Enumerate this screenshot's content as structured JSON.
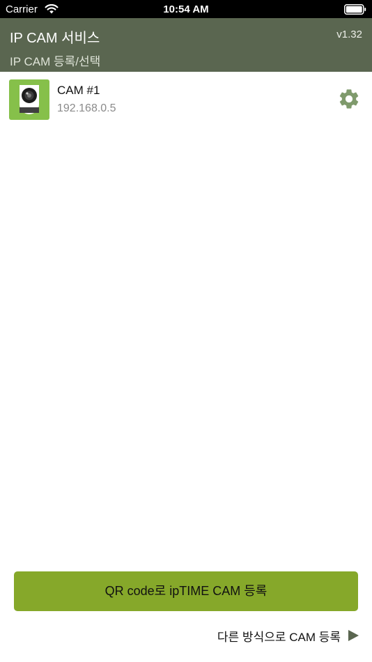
{
  "status_bar": {
    "carrier": "Carrier",
    "time": "10:54 AM",
    "icons": [
      "wifi-icon",
      "battery-icon"
    ]
  },
  "header": {
    "title": "IP CAM 서비스",
    "version": "v1.32",
    "subtitle": "IP CAM 등록/선택",
    "background_color": "#5a6650"
  },
  "cameras": [
    {
      "name": "CAM #1",
      "ip": "192.168.0.5",
      "icon": "camera-icon",
      "settings_icon": "gear-icon"
    }
  ],
  "actions": {
    "qr_register_label": "QR code로 ipTIME CAM 등록",
    "qr_register_color": "#86a82a",
    "other_register_label": "다른 방식으로 CAM 등록",
    "other_register_icon": "play-arrow-icon"
  }
}
